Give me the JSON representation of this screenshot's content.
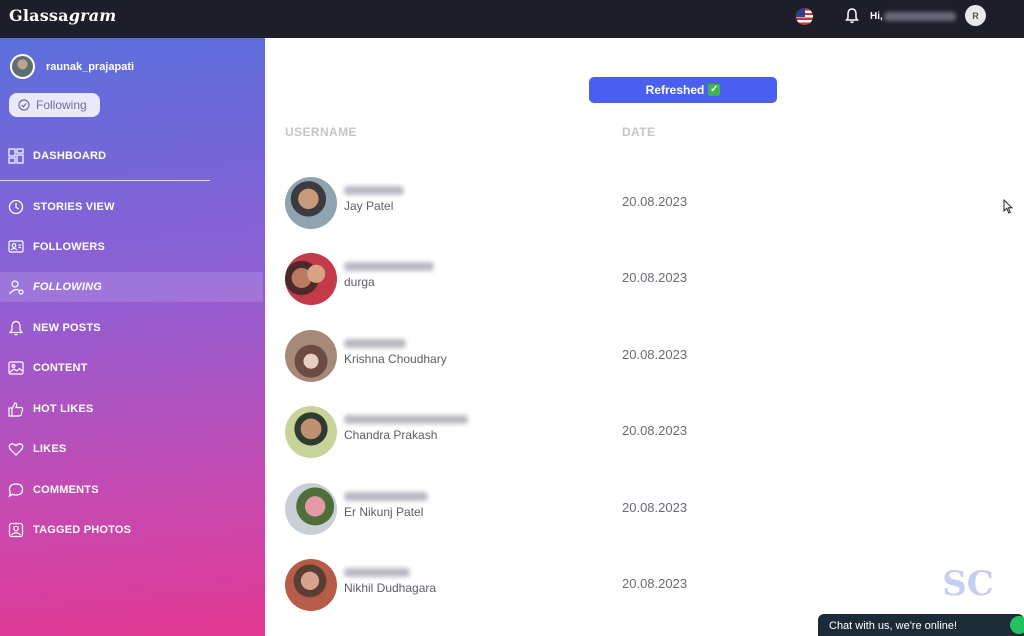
{
  "app": {
    "brand_plain": "Glassa",
    "brand_italic": "gram",
    "greeting": "Hi,",
    "avatar_initial": "R",
    "flag_icon": "us-flag-icon",
    "bell_icon": "bell-icon"
  },
  "sidebar": {
    "profile_name": "raunak_prajapati",
    "following_pill": "Following",
    "items": [
      {
        "label": "DASHBOARD",
        "icon": "dashboard-icon"
      },
      {
        "label": "STORIES VIEW",
        "icon": "clock-icon"
      },
      {
        "label": "FOLLOWERS",
        "icon": "followers-icon"
      },
      {
        "label": "FOLLOWING",
        "icon": "user-icon",
        "active": true
      },
      {
        "label": "NEW POSTS",
        "icon": "bell-icon"
      },
      {
        "label": "CONTENT",
        "icon": "image-icon"
      },
      {
        "label": "HOT LIKES",
        "icon": "thumbs-up-icon"
      },
      {
        "label": "LIKES",
        "icon": "heart-icon"
      },
      {
        "label": "COMMENTS",
        "icon": "comment-icon"
      },
      {
        "label": "TAGGED PHOTOS",
        "icon": "tag-icon"
      }
    ]
  },
  "main": {
    "refresh_label": "Refreshed",
    "refresh_check": "✓",
    "columns": {
      "username": "USERNAME",
      "date": "DATE"
    },
    "rows": [
      {
        "name": "Jay Patel",
        "date": "20.08.2023"
      },
      {
        "name": "durga",
        "date": "20.08.2023"
      },
      {
        "name": "Krishna Choudhary",
        "date": "20.08.2023"
      },
      {
        "name": "Chandra Prakash",
        "date": "20.08.2023"
      },
      {
        "name": "Er Nikunj Patel",
        "date": "20.08.2023"
      },
      {
        "name": "Nikhil Dudhagara",
        "date": "20.08.2023"
      }
    ]
  },
  "chat": {
    "label": "Chat with us, we're online!"
  },
  "watermark": {
    "text": "SC"
  },
  "colors": {
    "topbar": "#1e1e2b",
    "accent_button": "#4a5ef0",
    "sidebar_top": "#5b6fdd",
    "sidebar_bottom": "#e43a93"
  }
}
